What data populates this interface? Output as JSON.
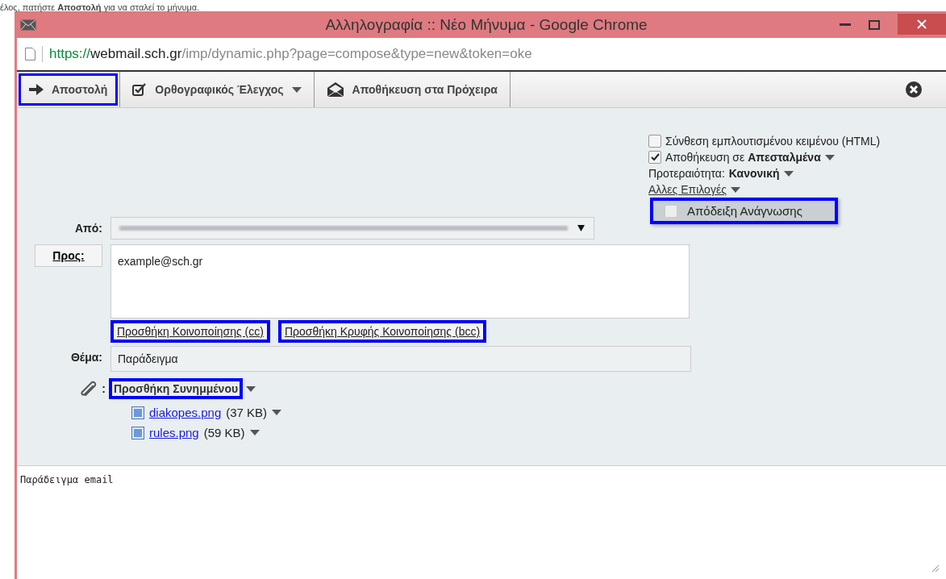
{
  "caption": "έλος, πατήστε **Αποστολή** για να σταλεί το μήνυμα.",
  "window": {
    "title": "Αλληλογραφία :: Νέο Μήνυμα - Google Chrome"
  },
  "address_bar": {
    "scheme": "https://",
    "host": "webmail.sch.gr",
    "path": "/imp/dynamic.php?page=compose&type=new&token=oke"
  },
  "toolbar": [
    {
      "kind": "send",
      "label": "Αποστολή",
      "highlighted": true,
      "dropdown": false
    },
    {
      "kind": "spellcheck",
      "label": "Ορθογραφικός Έλεγχος",
      "highlighted": false,
      "dropdown": true
    },
    {
      "kind": "draft",
      "label": "Αποθήκευση στα Πρόχειρα",
      "highlighted": false,
      "dropdown": false
    }
  ],
  "options": [
    {
      "kind": "checkbox",
      "label": "Σύνθεση εμπλουτισμένου κειμένου (HTML)",
      "checked": false,
      "dropdown": false
    },
    {
      "kind": "checkbox",
      "label": "Αποθήκευση σε **Απεσταλμένα**",
      "checked": true,
      "dropdown": true
    },
    {
      "kind": "select",
      "label": "Προτεραιότητα:",
      "value": "Κανονική",
      "dropdown": true
    },
    {
      "kind": "menu",
      "label": "Αλλες Επιλογές",
      "dropdown": true
    }
  ],
  "other_options_menu": [
    {
      "label": "Απόδειξη Ανάγνωσης",
      "checked": false,
      "highlighted": true
    }
  ],
  "from": {
    "label": "Από:"
  },
  "to": {
    "label": "Προς:",
    "value": "example@sch.gr"
  },
  "cc_buttons": [
    {
      "label": "Προσθήκη Κοινοποίησης (cc)",
      "highlighted": true
    },
    {
      "label": "Προσθήκη Κρυφής Κοινοποίησης (bcc)",
      "highlighted": true
    }
  ],
  "subject": {
    "label": "Θέμα:",
    "value": "Παράδειγμα"
  },
  "attach": {
    "separator": ":",
    "label": "Προσθήκη Συνημμένου",
    "highlighted": true
  },
  "attachments": [
    {
      "name": "diakopes.png",
      "size": "(37 KB)"
    },
    {
      "name": "rules.png",
      "size": "(59 KB)"
    }
  ],
  "body": "Παράδειγμα email"
}
